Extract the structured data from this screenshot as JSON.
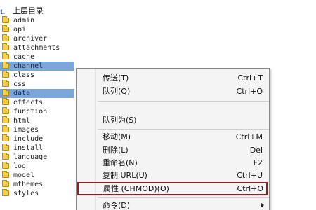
{
  "file_list": {
    "parent_dir_label": "上层目录",
    "folders": [
      {
        "name": "admin",
        "selected": false
      },
      {
        "name": "api",
        "selected": false
      },
      {
        "name": "archiver",
        "selected": false
      },
      {
        "name": "attachments",
        "selected": false
      },
      {
        "name": "cache",
        "selected": false
      },
      {
        "name": "channel",
        "selected": true
      },
      {
        "name": "class",
        "selected": false
      },
      {
        "name": "css",
        "selected": false
      },
      {
        "name": "data",
        "selected": true
      },
      {
        "name": "effects",
        "selected": false
      },
      {
        "name": "function",
        "selected": false
      },
      {
        "name": "html",
        "selected": false
      },
      {
        "name": "images",
        "selected": false
      },
      {
        "name": "include",
        "selected": false
      },
      {
        "name": "install",
        "selected": false
      },
      {
        "name": "language",
        "selected": false
      },
      {
        "name": "log",
        "selected": false
      },
      {
        "name": "model",
        "selected": false
      },
      {
        "name": "mthemes",
        "selected": false
      },
      {
        "name": "styles",
        "selected": false
      }
    ]
  },
  "context_menu": {
    "items": [
      {
        "label": "传送(T)",
        "shortcut": "Ctrl+T",
        "submenu": false,
        "highlighted": false
      },
      {
        "label": "队列(Q)",
        "shortcut": "Ctrl+Q",
        "submenu": false,
        "highlighted": false
      },
      {
        "label": "队列为(S)",
        "shortcut": "",
        "submenu": false,
        "highlighted": false
      },
      {
        "label": "移动(M)",
        "shortcut": "Ctrl+M",
        "submenu": false,
        "highlighted": false
      },
      {
        "label": "删除(L)",
        "shortcut": "Del",
        "submenu": false,
        "highlighted": false
      },
      {
        "label": "重命名(N)",
        "shortcut": "F2",
        "submenu": false,
        "highlighted": false
      },
      {
        "label": "复制 URL(U)",
        "shortcut": "Ctrl+U",
        "submenu": false,
        "highlighted": false
      },
      {
        "label": "属性 (CHMOD)(O)",
        "shortcut": "Ctrl+O",
        "submenu": false,
        "highlighted": true
      },
      {
        "label": "命令(D)",
        "shortcut": "",
        "submenu": true,
        "highlighted": false
      }
    ]
  },
  "colors": {
    "selection": "#7aa6d8",
    "highlight_outline": "#8d2027",
    "folder_yellow": "#f2cf4f",
    "menu_background": "#f4f4f4"
  }
}
